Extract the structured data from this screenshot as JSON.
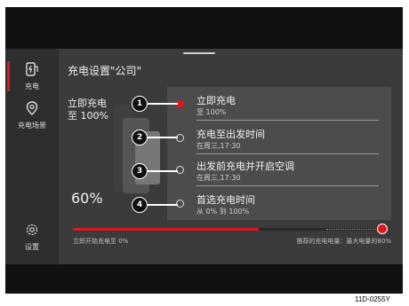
{
  "sidebar": {
    "items": [
      {
        "label": "充电",
        "icon": "charging-station-icon"
      },
      {
        "label": "充电场景",
        "icon": "location-pin-icon"
      },
      {
        "label": "设置",
        "icon": "gear-icon"
      }
    ]
  },
  "header": {
    "title": "充电设置\"公司\""
  },
  "status": {
    "line1": "立即充电",
    "line2": "至 100%",
    "percent": "60%"
  },
  "menu": {
    "items": [
      {
        "callout": "1",
        "title": "立即充电",
        "subtitle": "至 100%",
        "selected": true
      },
      {
        "callout": "2",
        "title": "充电至出发时间",
        "subtitle": "在周三,17:30",
        "selected": false
      },
      {
        "callout": "3",
        "title": "出发前充电并开启空调",
        "subtitle": "在周三,17:30",
        "selected": false
      },
      {
        "callout": "4",
        "title": "首选充电时间",
        "subtitle": "从 0% 到 100%",
        "selected": false
      }
    ]
  },
  "progress": {
    "current_fraction": 0.6,
    "target_fraction": 1.0,
    "recommended_fraction": 0.8,
    "left_label": "立即开始充电至 0%",
    "right_label": "推荐的充电电量：最大电量的80%"
  },
  "colors": {
    "accent": "#e0161b",
    "panel": "#3b3b3b",
    "menu": "#4c4c4c"
  },
  "figure_code": "11D-0255Y"
}
